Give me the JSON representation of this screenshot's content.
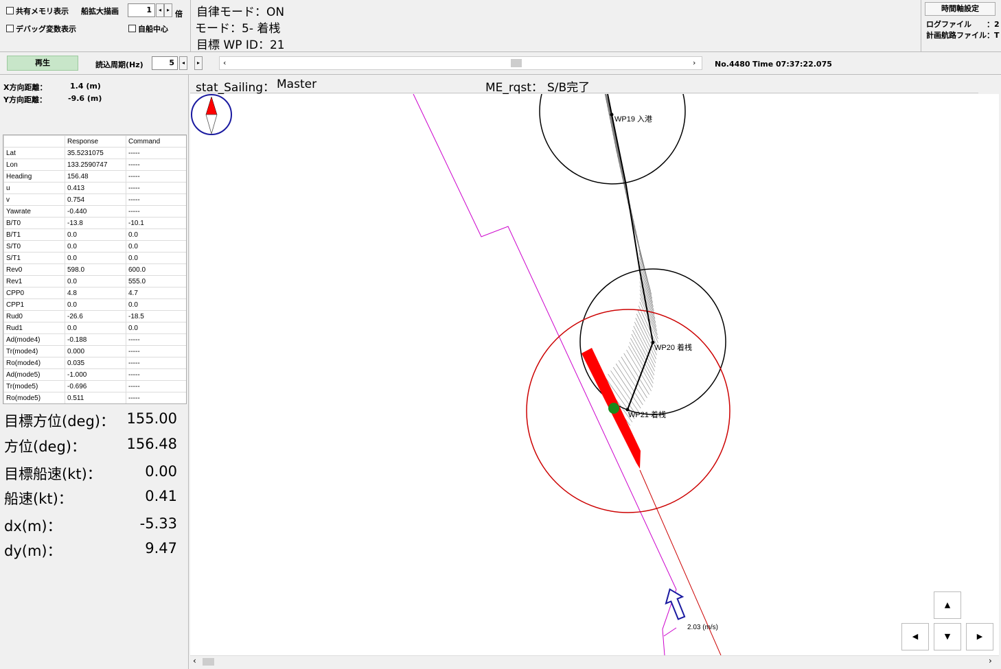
{
  "toolbar": {
    "shared_memory_label": "共有メモリ表示",
    "debug_vars_label": "デバッグ変数表示",
    "ship_zoom_label": "船拡大描画",
    "ship_zoom_value": "1",
    "ship_zoom_unit": "倍",
    "own_ship_center_label": "自船中心"
  },
  "status": {
    "autonomous_mode": "自律モード：ON",
    "mode": "モード：5- 着桟",
    "target_wp": "目標 WP ID：21"
  },
  "time_axis": {
    "button_label": "時間軸設定",
    "log_file_label": "ログファイル　　：2",
    "plan_file_label": "計画航路ファイル：T"
  },
  "playback": {
    "play_label": "再生",
    "read_cycle_label": "読込周期(Hz)",
    "read_cycle_value": "5",
    "record_no": "No.4480",
    "time": "Time 07:37:22.075"
  },
  "distance": {
    "x_label": "X方向距離：",
    "x_value": "1.4 (m)",
    "y_label": "Y方向距離：",
    "y_value": "-9.6 (m)"
  },
  "table": {
    "headers": [
      "",
      "Response",
      "Command"
    ],
    "rows": [
      [
        "Lat",
        "35.5231075",
        "-----"
      ],
      [
        "Lon",
        "133.2590747",
        "-----"
      ],
      [
        "Heading",
        "156.48",
        "-----"
      ],
      [
        "u",
        "0.413",
        "-----"
      ],
      [
        "v",
        "0.754",
        "-----"
      ],
      [
        "Yawrate",
        "-0.440",
        "-----"
      ],
      [
        "B/T0",
        "-13.8",
        "-10.1"
      ],
      [
        "B/T1",
        "0.0",
        "0.0"
      ],
      [
        "S/T0",
        "0.0",
        "0.0"
      ],
      [
        "S/T1",
        "0.0",
        "0.0"
      ],
      [
        "Rev0",
        "598.0",
        "600.0"
      ],
      [
        "Rev1",
        "0.0",
        "555.0"
      ],
      [
        "CPP0",
        "4.8",
        "4.7"
      ],
      [
        "CPP1",
        "0.0",
        "0.0"
      ],
      [
        "Rud0",
        "-26.6",
        "-18.5"
      ],
      [
        "Rud1",
        "0.0",
        "0.0"
      ],
      [
        "Ad(mode4)",
        "-0.188",
        "-----"
      ],
      [
        "Tr(mode4)",
        "0.000",
        "-----"
      ],
      [
        "Ro(mode4)",
        "0.035",
        "-----"
      ],
      [
        "Ad(mode5)",
        "-1.000",
        "-----"
      ],
      [
        "Tr(mode5)",
        "-0.696",
        "-----"
      ],
      [
        "Ro(mode5)",
        "0.511",
        "-----"
      ]
    ]
  },
  "info": [
    {
      "label": "目標方位(deg)：",
      "value": "155.00"
    },
    {
      "label": "方位(deg)：",
      "value": "156.48"
    },
    {
      "label": "目標船速(kt)：",
      "value": "0.00"
    },
    {
      "label": "船速(kt)：",
      "value": "0.41"
    },
    {
      "label": "dx(m)：",
      "value": "-5.33"
    },
    {
      "label": "dy(m)：",
      "value": "9.47"
    }
  ],
  "map": {
    "stat_label": "stat_Sailing：",
    "stat_value": "Master",
    "me_label": "ME_rqst：",
    "me_value": "S/B完了",
    "wp19_label": "WP19 入港",
    "wp20_label": "WP20 着桟",
    "wp21_label": "WP21 着桟",
    "current_label": "2.03 (m/s)",
    "colors": {
      "ship": "#ff0000",
      "target_circle": "#cc0000",
      "wp_circle": "#000000",
      "boundary": "#cc00cc",
      "track_hull": "#808080",
      "compass": "#1a1aa0"
    }
  },
  "icons": {
    "up": "up-arrow-icon",
    "down": "down-arrow-icon",
    "left": "left-arrow-icon",
    "right": "right-arrow-icon"
  }
}
